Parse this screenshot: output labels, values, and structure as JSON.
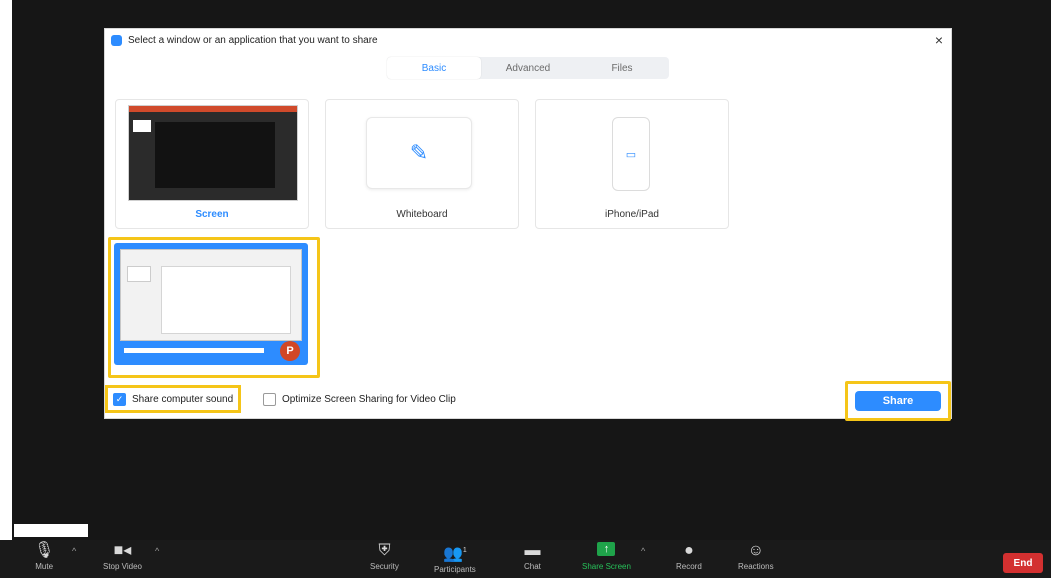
{
  "dialog": {
    "title": "Select a window or an application that you want to share",
    "close_glyph": "×",
    "tabs": [
      {
        "label": "Basic",
        "active": true
      },
      {
        "label": "Advanced",
        "active": false
      },
      {
        "label": "Files",
        "active": false
      }
    ],
    "cards": [
      {
        "label": "Screen",
        "selected": true
      },
      {
        "label": "Whiteboard",
        "selected": false
      },
      {
        "label": "iPhone/iPad",
        "selected": false
      }
    ],
    "app_window": {
      "app_icon_letter": "P"
    },
    "share_sound_label": "Share computer sound",
    "share_sound_checked": true,
    "optimize_label": "Optimize Screen Sharing for Video Clip",
    "optimize_checked": false,
    "share_button_label": "Share"
  },
  "toolbar": {
    "items": [
      {
        "label": "Mute",
        "icon": "microphone-icon"
      },
      {
        "label": "Stop Video",
        "icon": "video-camera-icon"
      },
      {
        "label": "Security",
        "icon": "shield-icon"
      },
      {
        "label": "Participants",
        "icon": "participants-icon",
        "count": "1"
      },
      {
        "label": "Chat",
        "icon": "chat-icon"
      },
      {
        "label": "Share Screen",
        "icon": "share-screen-icon"
      },
      {
        "label": "Record",
        "icon": "record-icon"
      },
      {
        "label": "Reactions",
        "icon": "reactions-icon"
      }
    ],
    "end_label": "End"
  },
  "colors": {
    "accent": "#2d8cff",
    "highlight": "#f5c518",
    "share_green": "#27c25a",
    "end_red": "#d33030"
  }
}
